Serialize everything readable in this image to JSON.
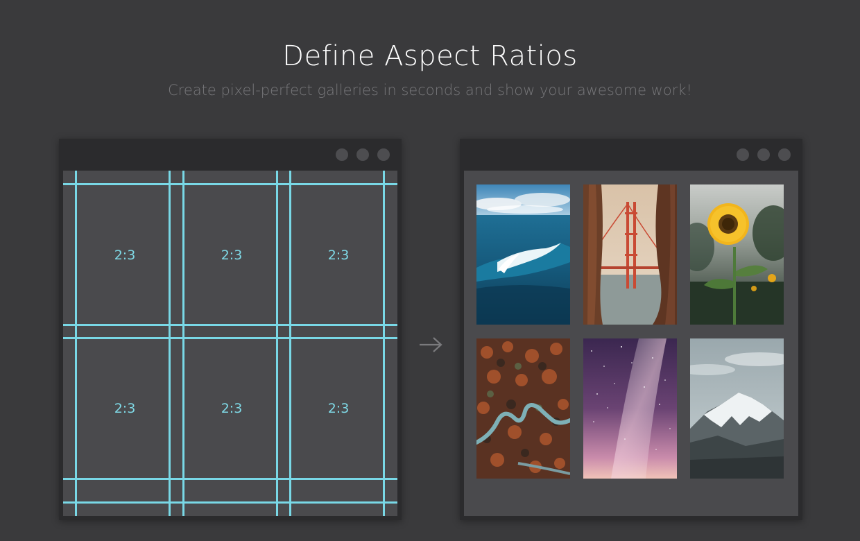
{
  "header": {
    "title": "Define Aspect Ratios",
    "subtitle": "Create pixel-perfect galleries in seconds and show your awesome work!"
  },
  "colors": {
    "background": "#3a3a3c",
    "window_frame": "#2b2b2d",
    "window_content": "#4a4a4d",
    "guide_line": "#79d8e6",
    "window_dot": "#4d4d50"
  },
  "left_window": {
    "cells": [
      "2:3",
      "2:3",
      "2:3",
      "2:3",
      "2:3",
      "2:3"
    ]
  },
  "arrow_icon": "arrow-right-icon",
  "right_window": {
    "photos": [
      "ocean-wave",
      "golden-gate-bridge",
      "sunflower",
      "winding-river-forest",
      "milky-way-sky",
      "snowy-mountain"
    ]
  }
}
